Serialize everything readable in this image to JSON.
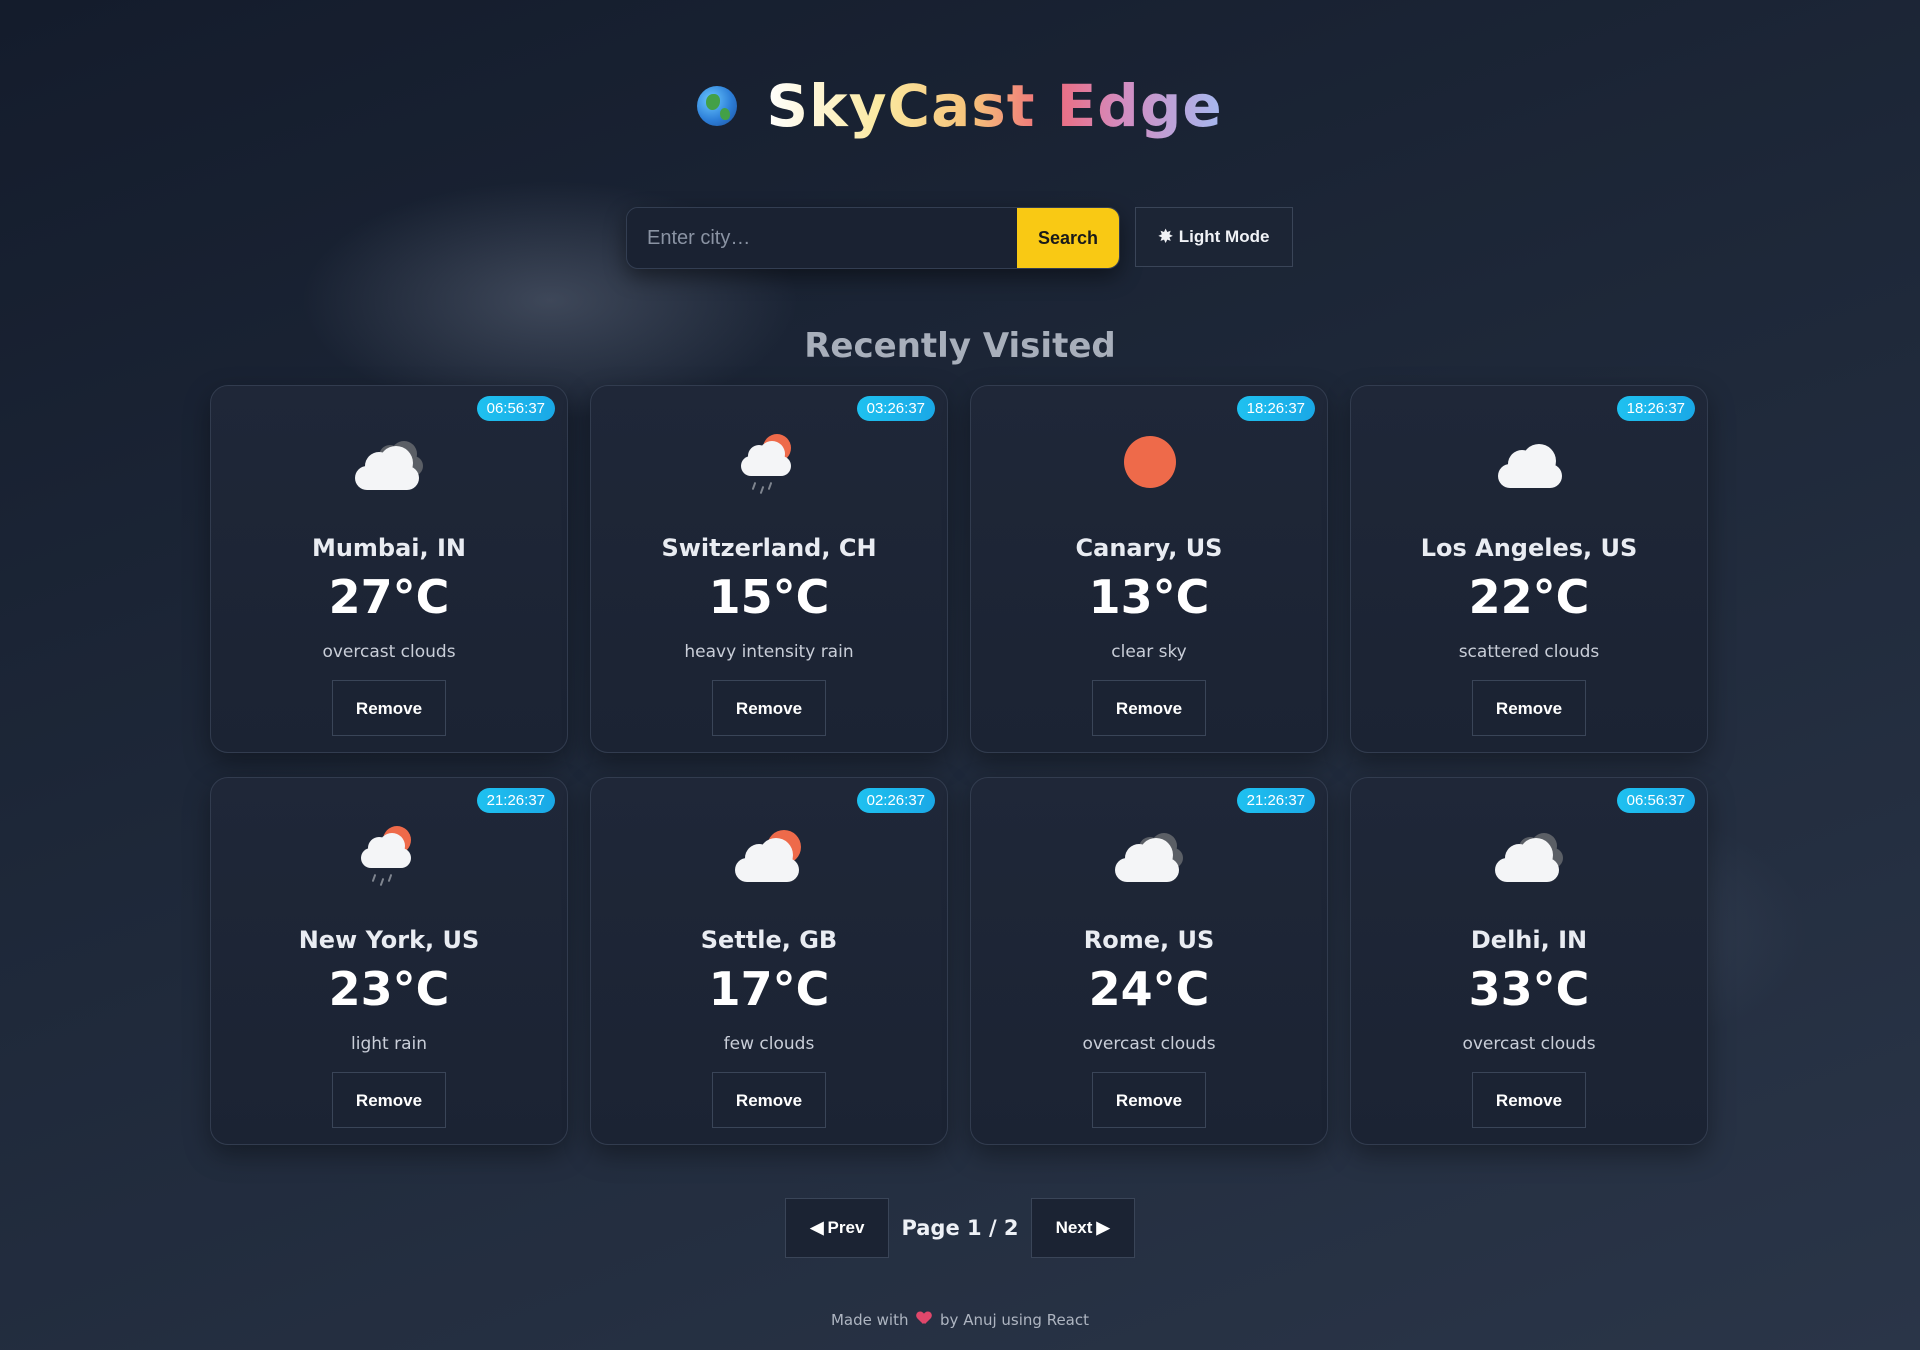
{
  "header": {
    "title": "SkyCast Edge",
    "icon": "globe-icon"
  },
  "search": {
    "placeholder": "Enter city…",
    "button_label": "Search"
  },
  "theme_toggle": {
    "icon": "✸",
    "label": "Light Mode"
  },
  "section_title": "Recently Visited",
  "cards": [
    {
      "time": "06:56:37",
      "city": "Mumbai, IN",
      "temp": "27°C",
      "desc": "overcast clouds",
      "icon": "overcast-clouds-icon",
      "remove_label": "Remove"
    },
    {
      "time": "03:26:37",
      "city": "Switzerland, CH",
      "temp": "15°C",
      "desc": "heavy intensity rain",
      "icon": "rain-sun-icon",
      "remove_label": "Remove"
    },
    {
      "time": "18:26:37",
      "city": "Canary, US",
      "temp": "13°C",
      "desc": "clear sky",
      "icon": "sun-icon",
      "remove_label": "Remove"
    },
    {
      "time": "18:26:37",
      "city": "Los Angeles, US",
      "temp": "22°C",
      "desc": "scattered clouds",
      "icon": "cloud-icon",
      "remove_label": "Remove"
    },
    {
      "time": "21:26:37",
      "city": "New York, US",
      "temp": "23°C",
      "desc": "light rain",
      "icon": "rain-sun-icon",
      "remove_label": "Remove"
    },
    {
      "time": "02:26:37",
      "city": "Settle, GB",
      "temp": "17°C",
      "desc": "few clouds",
      "icon": "few-clouds-icon",
      "remove_label": "Remove"
    },
    {
      "time": "21:26:37",
      "city": "Rome, US",
      "temp": "24°C",
      "desc": "overcast clouds",
      "icon": "overcast-clouds-icon",
      "remove_label": "Remove"
    },
    {
      "time": "06:56:37",
      "city": "Delhi, IN",
      "temp": "33°C",
      "desc": "overcast clouds",
      "icon": "overcast-clouds-icon",
      "remove_label": "Remove"
    }
  ],
  "pagination": {
    "prev_label": "Prev",
    "next_label": "Next",
    "page_label": "Page 1 / 2"
  },
  "footer": {
    "prefix": "Made with",
    "suffix": "by Anuj using React"
  },
  "colors": {
    "accent_yellow": "#f9c914",
    "badge_cyan": "#1ec1f0",
    "sun_orange": "#ee6a4a",
    "heart_pink": "#e0476b"
  }
}
